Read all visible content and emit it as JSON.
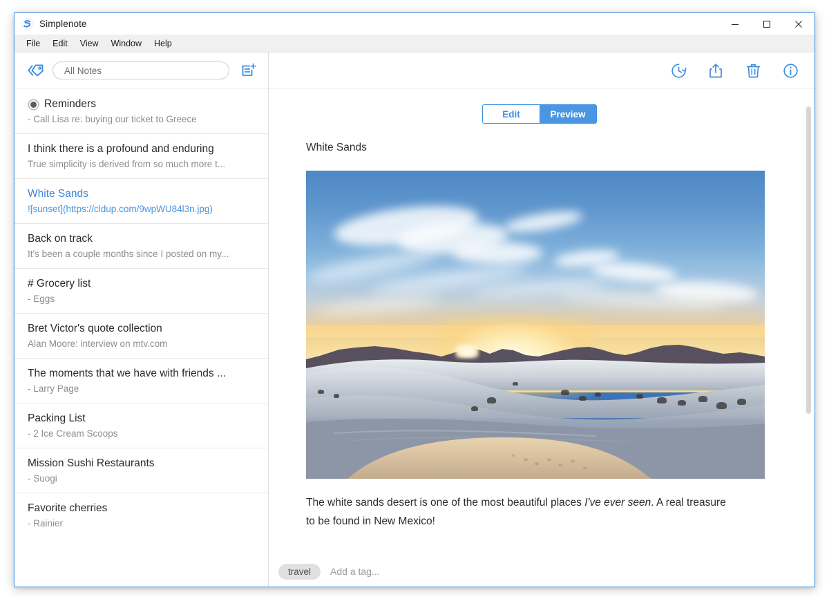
{
  "window": {
    "title": "Simplenote",
    "app_icon": "simplenote-logo-icon",
    "controls": {
      "minimize": "minimize-icon",
      "maximize": "maximize-icon",
      "close": "close-icon"
    }
  },
  "menubar": {
    "items": [
      {
        "label": "File"
      },
      {
        "label": "Edit"
      },
      {
        "label": "View"
      },
      {
        "label": "Window"
      },
      {
        "label": "Help"
      }
    ]
  },
  "left_toolbar": {
    "tags_icon": "tags-icon",
    "search": {
      "value": "",
      "placeholder": "All Notes"
    },
    "new_note_icon": "new-note-icon"
  },
  "right_toolbar": {
    "icons": [
      {
        "name": "history-icon"
      },
      {
        "name": "share-icon"
      },
      {
        "name": "trash-icon"
      },
      {
        "name": "info-icon"
      }
    ]
  },
  "notes": [
    {
      "title": "Reminders",
      "preview": "- Call Lisa re: buying our ticket to Greece",
      "pinned": true,
      "selected": false
    },
    {
      "title": "I think there is a profound and enduring",
      "preview": "True simplicity is derived from so much more t...",
      "pinned": false,
      "selected": false
    },
    {
      "title": "White Sands",
      "preview": "![sunset](https://cldup.com/9wpWU84l3n.jpg)",
      "pinned": false,
      "selected": true
    },
    {
      "title": "Back on track",
      "preview": "It's been a couple months since I posted on my...",
      "pinned": false,
      "selected": false
    },
    {
      "title": "# Grocery list",
      "preview": "- Eggs",
      "pinned": false,
      "selected": false
    },
    {
      "title": "Bret Victor's quote collection",
      "preview": "Alan Moore: interview on mtv.com",
      "pinned": false,
      "selected": false
    },
    {
      "title": "The moments that we have with friends ...",
      "preview": "- Larry Page",
      "pinned": false,
      "selected": false
    },
    {
      "title": "Packing List",
      "preview": "- 2 Ice Cream Scoops",
      "pinned": false,
      "selected": false
    },
    {
      "title": "Mission Sushi Restaurants",
      "preview": "- Suogi",
      "pinned": false,
      "selected": false
    },
    {
      "title": "Favorite cherries",
      "preview": "- Rainier",
      "pinned": false,
      "selected": false
    }
  ],
  "editor": {
    "mode_edit_label": "Edit",
    "mode_preview_label": "Preview",
    "active_mode": "Preview",
    "heading": "White Sands",
    "image_alt": "sunset",
    "body_before_em": "The white sands desert is one of the most beautiful places ",
    "body_em": "I've ever seen",
    "body_after_em": ". A real treasure to be found in New Mexico!"
  },
  "tag_bar": {
    "tags": [
      {
        "label": "travel"
      }
    ],
    "add_tag_value": "",
    "add_tag_placeholder": "Add a tag..."
  },
  "colors": {
    "accent_blue": "#4a96e2",
    "link_blue": "#3a86d6",
    "window_border": "#4f9ae0",
    "menubar_bg": "#f0f0f0",
    "divider": "#e7e7e7",
    "tag_chip_bg": "#e0e0e0"
  }
}
